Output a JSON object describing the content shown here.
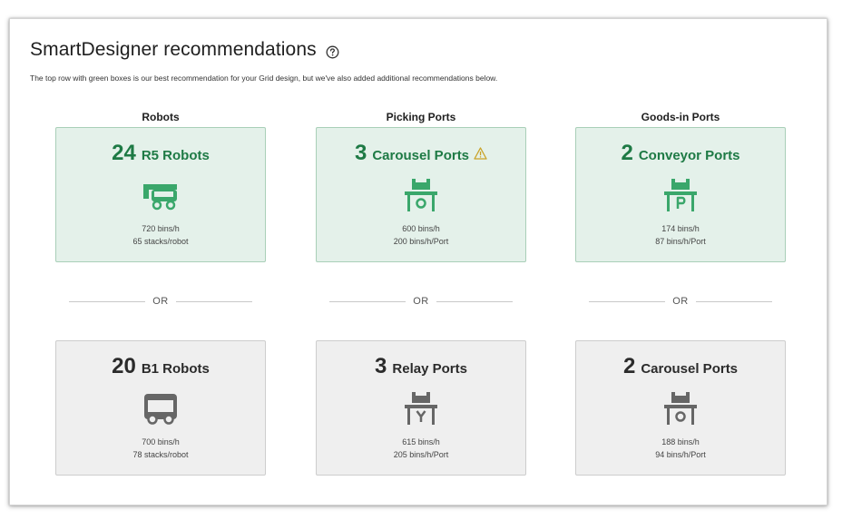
{
  "header": {
    "title": "SmartDesigner recommendations",
    "subtitle": "The top row with green boxes is our best recommendation for your Grid design, but we've also added additional recommendations below."
  },
  "colors": {
    "recommended_bg": "#e4f1ea",
    "recommended_border": "#a9cfb8",
    "recommended_text": "#1e7a45",
    "icon_green": "#3aa76b",
    "alternative_bg": "#efefef",
    "alternative_border": "#cdcdcd",
    "icon_gray": "#666666",
    "warning": "#c9a227"
  },
  "or_label": "OR",
  "columns": [
    {
      "heading": "Robots",
      "recommended": {
        "count": "24",
        "name": "R5 Robots",
        "icon": "r5-robot-icon",
        "stat1": "720 bins/h",
        "stat2": "65 stacks/robot"
      },
      "alternative": {
        "count": "20",
        "name": "B1 Robots",
        "icon": "b1-robot-icon",
        "stat1": "700 bins/h",
        "stat2": "78 stacks/robot"
      }
    },
    {
      "heading": "Picking Ports",
      "recommended": {
        "count": "3",
        "name": "Carousel Ports",
        "icon": "carousel-port-icon",
        "warning_icon": "warning-icon",
        "stat1": "600 bins/h",
        "stat2": "200 bins/h/Port"
      },
      "alternative": {
        "count": "3",
        "name": "Relay Ports",
        "icon": "relay-port-icon",
        "stat1": "615 bins/h",
        "stat2": "205 bins/h/Port"
      }
    },
    {
      "heading": "Goods-in Ports",
      "recommended": {
        "count": "2",
        "name": "Conveyor Ports",
        "icon": "conveyor-port-icon",
        "stat1": "174 bins/h",
        "stat2": "87 bins/h/Port"
      },
      "alternative": {
        "count": "2",
        "name": "Carousel Ports",
        "icon": "carousel-port-icon",
        "stat1": "188 bins/h",
        "stat2": "94 bins/h/Port"
      }
    }
  ]
}
